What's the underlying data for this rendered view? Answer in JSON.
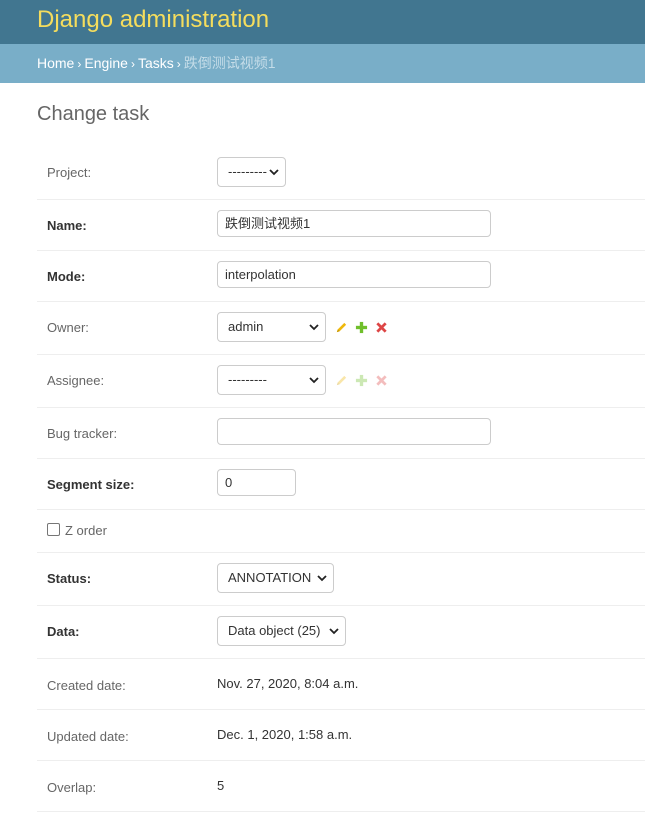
{
  "header": {
    "site_name": "Django administration"
  },
  "breadcrumbs": {
    "home": "Home",
    "app": "Engine",
    "model": "Tasks",
    "current": "跌倒测试视频1",
    "separator": "›"
  },
  "page": {
    "title": "Change task"
  },
  "form": {
    "project": {
      "label": "Project:",
      "value": "---------"
    },
    "name": {
      "label": "Name:",
      "value": "跌倒测试视频1"
    },
    "mode": {
      "label": "Mode:",
      "value": "interpolation"
    },
    "owner": {
      "label": "Owner:",
      "value": "admin"
    },
    "assignee": {
      "label": "Assignee:",
      "value": "---------"
    },
    "bug_tracker": {
      "label": "Bug tracker:",
      "value": ""
    },
    "segment_size": {
      "label": "Segment size:",
      "value": "0"
    },
    "z_order": {
      "label": "Z order",
      "checked": false
    },
    "status": {
      "label": "Status:",
      "value": "ANNOTATION"
    },
    "data": {
      "label": "Data:",
      "value": "Data object (25)"
    },
    "created_date": {
      "label": "Created date:",
      "value": "Nov. 27, 2020, 8:04 a.m."
    },
    "updated_date": {
      "label": "Updated date:",
      "value": "Dec. 1, 2020, 1:58 a.m."
    },
    "overlap": {
      "label": "Overlap:",
      "value": "5"
    }
  },
  "icons": {
    "change": "pencil-icon",
    "add": "plus-icon",
    "delete": "x-icon"
  },
  "colors": {
    "header_bg": "#417690",
    "breadcrumb_bg": "#79aec8",
    "site_name": "#f5dd5d",
    "change_icon": "#efb80b",
    "add_icon": "#70bf2b",
    "delete_icon": "#dd4646"
  }
}
